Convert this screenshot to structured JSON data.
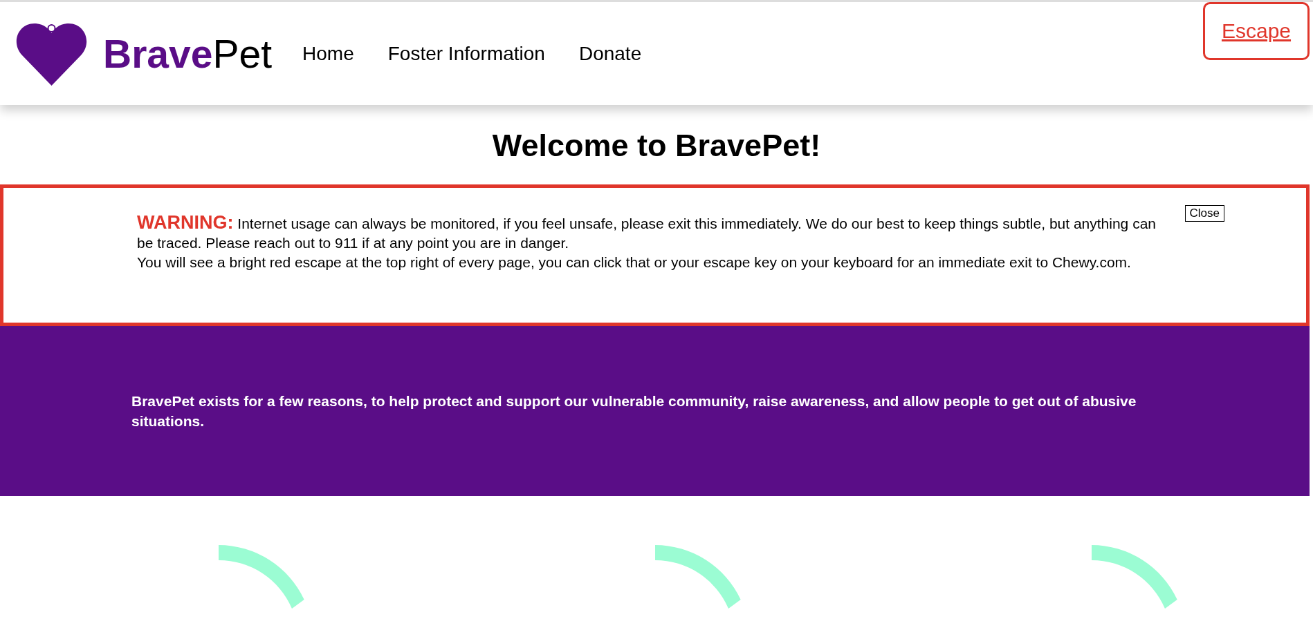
{
  "header": {
    "logo": {
      "brand_bold": "Brave",
      "brand_rest": "Pet"
    },
    "nav": [
      {
        "label": "Home"
      },
      {
        "label": "Foster Information"
      },
      {
        "label": "Donate"
      }
    ],
    "escape_link": "Escape"
  },
  "title": "Welcome to BravePet!",
  "warning": {
    "label": "WARNING:",
    "lines": [
      "Internet usage can always be monitored, if you feel unsafe, please exit this immediately. We do our best to keep things subtle, but anything can be traced. Please reach out to 911 if at any point you are in danger.",
      "You will see a bright red escape at the top right of every page, you can click that or your escape key on your keyboard for an immediate exit to Chewy.com."
    ],
    "close_button": "Close"
  },
  "mission": "BravePet exists for a few reasons, to help protect and support our vulnerable community, raise awareness, and allow people to get out of abusive situations.",
  "rings": [
    {
      "kind": "ring"
    },
    {
      "kind": "ring"
    },
    {
      "kind": "ring"
    }
  ]
}
